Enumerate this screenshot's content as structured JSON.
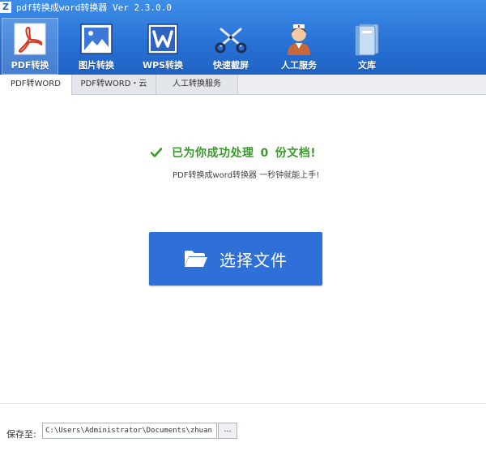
{
  "app": {
    "logo_glyph": "Z",
    "title": "pdf转换成word转换器 Ver 2.3.0.0"
  },
  "toolbar": {
    "items": [
      {
        "label": "PDF转换",
        "icon": "pdf-icon",
        "active": true
      },
      {
        "label": "图片转换",
        "icon": "image-icon",
        "active": false
      },
      {
        "label": "WPS转换",
        "icon": "wps-icon",
        "active": false
      },
      {
        "label": "快速截屏",
        "icon": "scissors-icon",
        "active": false
      },
      {
        "label": "人工服务",
        "icon": "support-person-icon",
        "active": false
      },
      {
        "label": "文库",
        "icon": "library-book-icon",
        "active": false
      }
    ]
  },
  "tabs": [
    {
      "label": "PDF转WORD",
      "active": true
    },
    {
      "label": "PDF转WORD・云",
      "active": false
    },
    {
      "label": "人工转换服务",
      "active": false
    }
  ],
  "main": {
    "status_prefix": "已为你成功处理",
    "processed_count": "0",
    "status_suffix": "份文档!",
    "subtitle": "PDF转换成word转换器 一秒钟就能上手!",
    "select_button_label": "选择文件"
  },
  "footer": {
    "save_label": "保存至:",
    "save_path": "C:\\Users\\Administrator\\Documents\\zhuan",
    "browse_label": "..."
  },
  "colors": {
    "header_blue": "#2a72d6",
    "button_blue": "#2f6fd8",
    "success_green": "#3a9a2c"
  }
}
